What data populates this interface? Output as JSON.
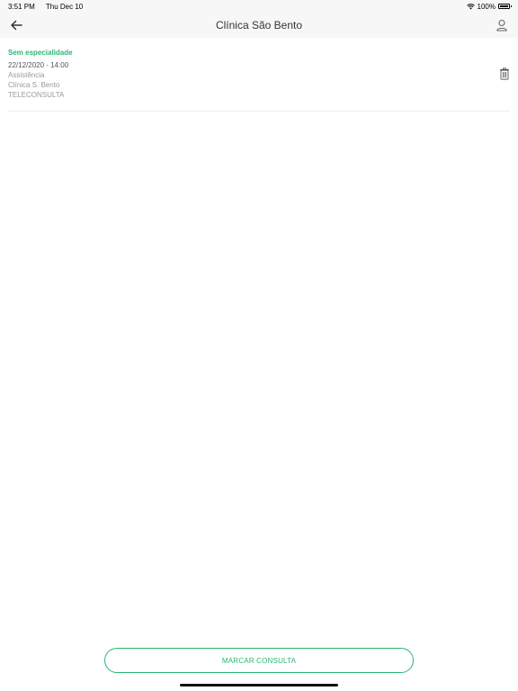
{
  "status_bar": {
    "time": "3:51 PM",
    "date": "Thu Dec 10",
    "battery": "100%"
  },
  "nav": {
    "title": "Clínica São Bento",
    "back_icon": "arrow-left-icon",
    "user_icon": "user-icon"
  },
  "appointments": [
    {
      "specialty": "Sem especialidade",
      "datetime": "22/12/2020 - 14:00",
      "service": "Assistência",
      "clinic": "Clínica S. Bento",
      "type": "TELECONSULTA"
    }
  ],
  "cta": {
    "label": "MARCAR CONSULTA"
  },
  "colors": {
    "accent": "#2bb673",
    "bar_background": "#f7f7f7"
  }
}
